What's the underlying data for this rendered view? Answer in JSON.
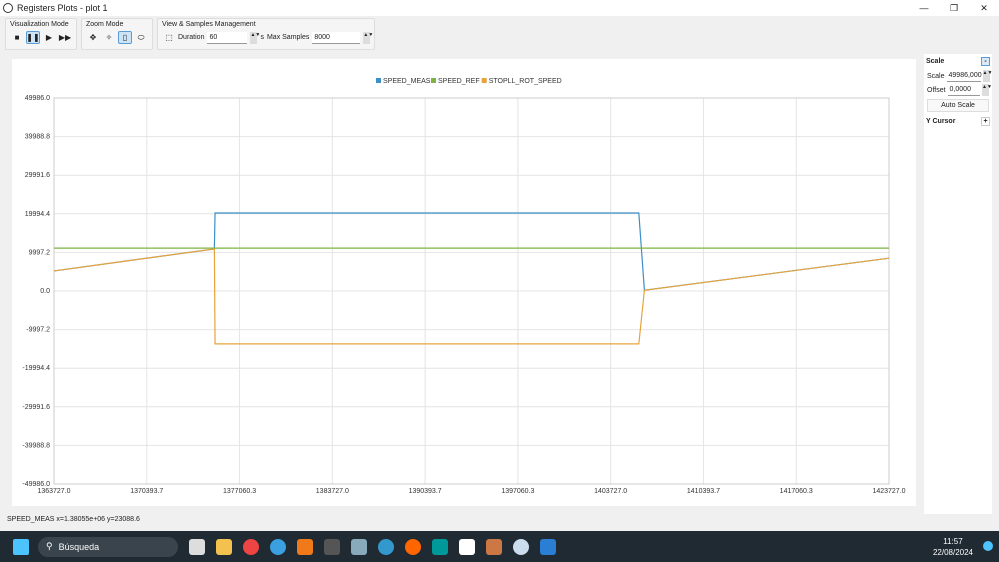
{
  "window": {
    "title": "Registers Plots - plot 1"
  },
  "toolbar": {
    "visualization_mode": "Visualization Mode",
    "zoom_mode": "Zoom Mode",
    "view_samples": "View & Samples Management",
    "duration_label": "Duration",
    "duration_value": "60",
    "duration_unit": "s",
    "max_samples_label": "Max Samples",
    "max_samples_value": "8000"
  },
  "side": {
    "scale_title": "Scale",
    "scale_label": "Scale",
    "scale_value": "49986,000",
    "offset_label": "Offset",
    "offset_value": "0,0000",
    "auto_scale": "Auto Scale",
    "y_cursor": "Y Cursor",
    "collapse": "-",
    "expand": "+"
  },
  "status": "SPEED_MEAS x=1.38055e+06 y=23088.6",
  "taskbar": {
    "search": "Búsqueda",
    "time": "11:57",
    "date": "22/08/2024"
  },
  "chart_data": {
    "type": "line",
    "xlim": [
      1363727.0,
      1423727.0
    ],
    "ylim": [
      -49986.0,
      49986.0
    ],
    "xticks": [
      "1363727.0",
      "1370393.7",
      "1377060.3",
      "1383727.0",
      "1390393.7",
      "1397060.3",
      "1403727.0",
      "1410393.7",
      "1417060.3",
      "1423727.0"
    ],
    "yticks": [
      "49986.0",
      "39988.8",
      "29991.6",
      "19994.4",
      "9997.2",
      "0.0",
      "-9997.2",
      "-19994.4",
      "-29991.6",
      "-39988.8",
      "-49986.0"
    ],
    "grid": true,
    "legend": "top-center",
    "series": [
      {
        "name": "SPEED_MEAS",
        "color": "#3c8fc8",
        "x": [
          1363727,
          1375250,
          1375300,
          1405750,
          1406150,
          1423727
        ],
        "y": [
          5200,
          10900,
          20200,
          20200,
          200,
          8500
        ]
      },
      {
        "name": "SPEED_REF",
        "color": "#7cb342",
        "x": [
          1363727,
          1423727
        ],
        "y": [
          11100,
          11100
        ]
      },
      {
        "name": "STOPLL_ROT_SPEED",
        "color": "#e8a33a",
        "x": [
          1363727,
          1375250,
          1375300,
          1405750,
          1406150,
          1423727
        ],
        "y": [
          5200,
          10900,
          -13700,
          -13700,
          200,
          8500
        ]
      }
    ]
  }
}
